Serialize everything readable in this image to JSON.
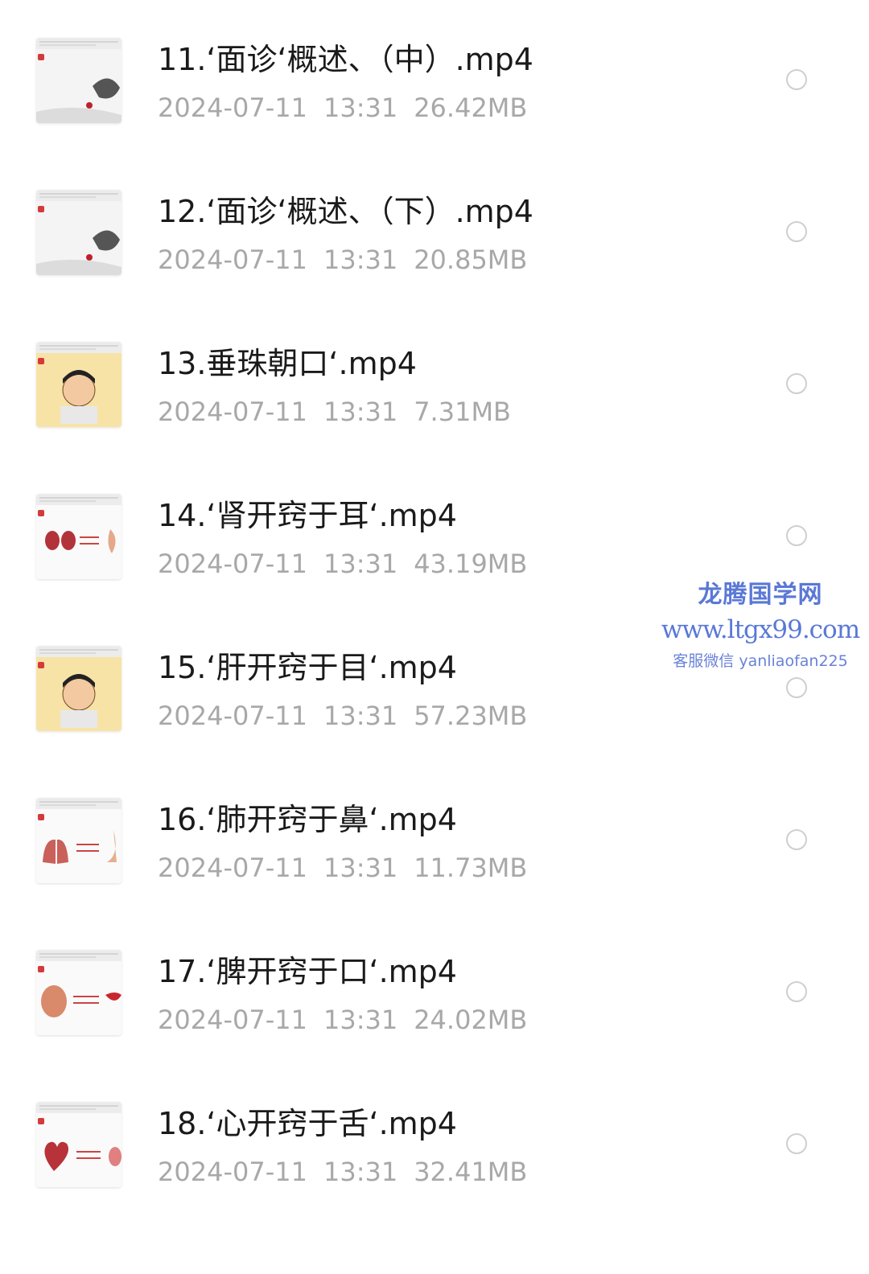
{
  "files": [
    {
      "name": "11.‘面诊‘概述、（中）.mp4",
      "date": "2024-07-11",
      "time": "13:31",
      "size": "26.42MB",
      "thumb": "thumb-slide-ink-icon",
      "thumb_label": "面诊"
    },
    {
      "name": "12.‘面诊‘概述、（下）.mp4",
      "date": "2024-07-11",
      "time": "13:31",
      "size": "20.85MB",
      "thumb": "thumb-slide-ink-icon",
      "thumb_label": "面诊"
    },
    {
      "name": "13.垂珠朝口‘.mp4",
      "date": "2024-07-11",
      "time": "13:31",
      "size": "7.31MB",
      "thumb": "thumb-slide-face-icon",
      "thumb_label": "面诊"
    },
    {
      "name": "14.‘肾开窍于耳‘.mp4",
      "date": "2024-07-11",
      "time": "13:31",
      "size": "43.19MB",
      "thumb": "thumb-slide-kidney-ear-icon",
      "thumb_label": "肾——耳"
    },
    {
      "name": "15.‘肝开窍于目‘.mp4",
      "date": "2024-07-11",
      "time": "13:31",
      "size": "57.23MB",
      "thumb": "thumb-slide-face-icon",
      "thumb_label": "面诊"
    },
    {
      "name": "16.‘肺开窍于鼻‘.mp4",
      "date": "2024-07-11",
      "time": "13:31",
      "size": "11.73MB",
      "thumb": "thumb-slide-lung-nose-icon",
      "thumb_label": "肺——鼻"
    },
    {
      "name": "17.‘脾开窍于口‘.mp4",
      "date": "2024-07-11",
      "time": "13:31",
      "size": "24.02MB",
      "thumb": "thumb-slide-spleen-mouth-icon",
      "thumb_label": "脾——口"
    },
    {
      "name": "18.‘心开窍于舌‘.mp4",
      "date": "2024-07-11",
      "time": "13:31",
      "size": "32.41MB",
      "thumb": "thumb-slide-heart-tongue-icon",
      "thumb_label": "心——舌"
    }
  ],
  "watermark": {
    "title": "龙腾国学网",
    "url": "www.ltgx99.com",
    "contact": "客服微信 yanliaofan225"
  },
  "colors": {
    "name_text": "#1a1a1a",
    "meta_text": "#a8a8a8",
    "radio_border": "#cfcfcf",
    "watermark": "#5a78d6"
  }
}
